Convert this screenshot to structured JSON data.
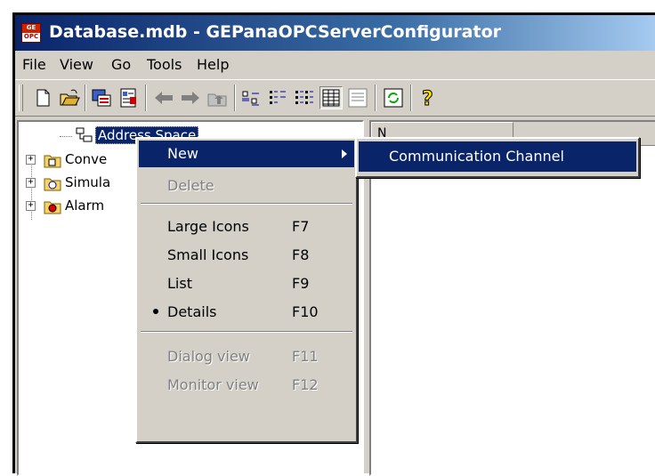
{
  "window": {
    "title": "Database.mdb - GEPanaOPCServerConfigurator",
    "app_icon_text_top": "GE",
    "app_icon_text_bottom": "OPC"
  },
  "menubar": [
    "File",
    "View",
    "Go",
    "Tools",
    "Help"
  ],
  "toolbar": {
    "buttons": [
      "new-file-icon",
      "open-folder-icon",
      "add-tag-icon",
      "properties-icon",
      "back-arrow-icon",
      "forward-arrow-icon",
      "up-folder-icon",
      "large-icons-view-icon",
      "small-icons-view-icon",
      "list-view-icon",
      "details-view-icon",
      "dialog-view-icon",
      "refresh-icon",
      "help-icon"
    ]
  },
  "tree": {
    "items": [
      {
        "label": "Address Space",
        "icon": "address-space-icon",
        "selected": true
      },
      {
        "label": "Conve",
        "icon": "folder-conversion-icon"
      },
      {
        "label": "Simula",
        "icon": "folder-simulation-icon"
      },
      {
        "label": "Alarm",
        "icon": "folder-alarm-icon"
      }
    ]
  },
  "list": {
    "column_header": "N"
  },
  "context_menu": {
    "items": [
      {
        "label": "New",
        "accelerator": "",
        "submenu": true,
        "highlight": true
      },
      {
        "label": "Delete",
        "accelerator": "",
        "disabled": true
      },
      {
        "label": "Large Icons",
        "accelerator": "F7"
      },
      {
        "label": "Small Icons",
        "accelerator": "F8"
      },
      {
        "label": "List",
        "accelerator": "F9"
      },
      {
        "label": "Details",
        "accelerator": "F10",
        "checked": true
      },
      {
        "label": "Dialog view",
        "accelerator": "F11",
        "disabled": true
      },
      {
        "label": "Monitor view",
        "accelerator": "F12",
        "disabled": true
      }
    ]
  },
  "submenu": {
    "items": [
      {
        "label": "Communication Channel",
        "highlight": true
      }
    ]
  },
  "colors": {
    "highlight": "#0a246a",
    "face": "#d4d0c8",
    "title_start": "#0a246a"
  }
}
